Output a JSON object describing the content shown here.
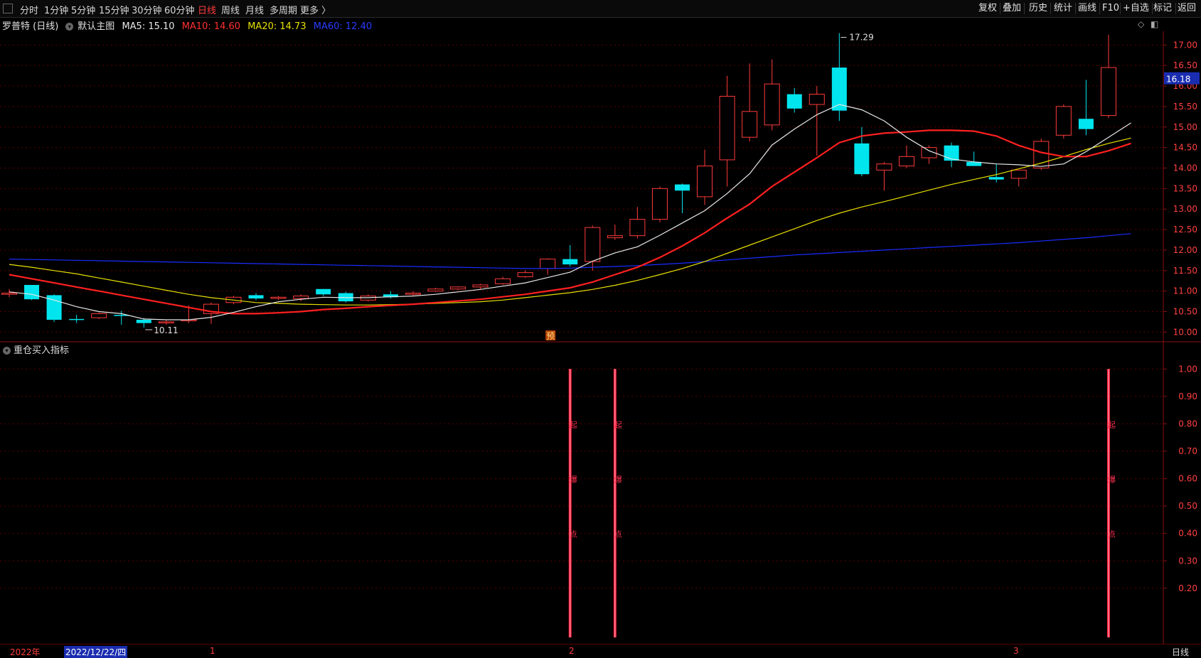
{
  "toolbar": {
    "periods": [
      "分时",
      "1分钟",
      "5分钟",
      "15分钟",
      "30分钟",
      "60分钟",
      "日线",
      "周线",
      "月线",
      "多周期",
      "更多 〉"
    ],
    "active_period": "日线",
    "right_buttons": [
      "复权",
      "叠加",
      "历史",
      "统计",
      "画线",
      "F10",
      "+自选",
      "标记",
      "返回"
    ]
  },
  "main_header": {
    "stock": "罗普特 (日线)",
    "template": "默认主图",
    "ma5": "MA5: 15.10",
    "ma10": "MA10: 14.60",
    "ma20": "MA20: 14.73",
    "ma60": "MA60: 12.40"
  },
  "sub_header": {
    "title": "重仓买入指标"
  },
  "bottom_bar": {
    "year_label": "2022年",
    "date_label": "2022/12/22/四",
    "month_ticks": [
      "1",
      "2",
      "3"
    ],
    "period_label": "日线"
  },
  "colors": {
    "up": "#ff3b3b",
    "down": "#00e5ee",
    "ma5": "#e8e8e8",
    "ma10": "#ff2020",
    "ma20": "#e8e000",
    "ma60": "#1a2cff",
    "grid": "#5a0000",
    "axis": "#8a1010"
  },
  "chart_data": {
    "type": "candlestick",
    "price_axis": {
      "range": [
        9.85,
        17.3
      ],
      "ticks": [
        "17.00",
        "16.50",
        "16.00",
        "15.50",
        "15.00",
        "14.50",
        "14.00",
        "13.50",
        "13.00",
        "12.50",
        "12.00",
        "11.50",
        "11.00",
        "10.50",
        "10.00"
      ]
    },
    "last_price_label": "16.18",
    "annotations": {
      "high": "17.29",
      "low": "10.11",
      "marker": "预"
    },
    "candles": [
      {
        "o": 10.92,
        "h": 11.05,
        "l": 10.85,
        "c": 10.95
      },
      {
        "o": 11.15,
        "h": 11.15,
        "l": 10.78,
        "c": 10.8
      },
      {
        "o": 10.9,
        "h": 10.92,
        "l": 10.25,
        "c": 10.3
      },
      {
        "o": 10.32,
        "h": 10.42,
        "l": 10.22,
        "c": 10.3
      },
      {
        "o": 10.35,
        "h": 10.48,
        "l": 10.32,
        "c": 10.45
      },
      {
        "o": 10.42,
        "h": 10.52,
        "l": 10.18,
        "c": 10.4
      },
      {
        "o": 10.3,
        "h": 10.34,
        "l": 10.11,
        "c": 10.22
      },
      {
        "o": 10.25,
        "h": 10.3,
        "l": 10.18,
        "c": 10.25
      },
      {
        "o": 10.3,
        "h": 10.65,
        "l": 10.22,
        "c": 10.3
      },
      {
        "o": 10.45,
        "h": 10.72,
        "l": 10.2,
        "c": 10.68
      },
      {
        "o": 10.72,
        "h": 10.88,
        "l": 10.68,
        "c": 10.85
      },
      {
        "o": 10.9,
        "h": 10.95,
        "l": 10.78,
        "c": 10.82
      },
      {
        "o": 10.82,
        "h": 10.88,
        "l": 10.78,
        "c": 10.85
      },
      {
        "o": 10.82,
        "h": 10.92,
        "l": 10.75,
        "c": 10.88
      },
      {
        "o": 11.05,
        "h": 11.05,
        "l": 10.88,
        "c": 10.92
      },
      {
        "o": 10.95,
        "h": 10.98,
        "l": 10.72,
        "c": 10.75
      },
      {
        "o": 10.78,
        "h": 10.92,
        "l": 10.75,
        "c": 10.88
      },
      {
        "o": 10.92,
        "h": 11.0,
        "l": 10.82,
        "c": 10.85
      },
      {
        "o": 10.92,
        "h": 11.0,
        "l": 10.88,
        "c": 10.95
      },
      {
        "o": 11.0,
        "h": 11.08,
        "l": 10.98,
        "c": 11.05
      },
      {
        "o": 11.05,
        "h": 11.12,
        "l": 11.02,
        "c": 11.1
      },
      {
        "o": 11.1,
        "h": 11.18,
        "l": 11.05,
        "c": 11.15
      },
      {
        "o": 11.18,
        "h": 11.35,
        "l": 11.15,
        "c": 11.3
      },
      {
        "o": 11.35,
        "h": 11.5,
        "l": 11.32,
        "c": 11.45
      },
      {
        "o": 11.55,
        "h": 11.8,
        "l": 11.4,
        "c": 11.78
      },
      {
        "o": 11.78,
        "h": 12.12,
        "l": 11.6,
        "c": 11.65
      },
      {
        "o": 11.72,
        "h": 12.6,
        "l": 11.5,
        "c": 12.55
      },
      {
        "o": 12.3,
        "h": 12.62,
        "l": 12.25,
        "c": 12.35
      },
      {
        "o": 12.35,
        "h": 13.05,
        "l": 12.28,
        "c": 12.75
      },
      {
        "o": 12.75,
        "h": 13.55,
        "l": 12.68,
        "c": 13.5
      },
      {
        "o": 13.6,
        "h": 13.62,
        "l": 12.9,
        "c": 13.45
      },
      {
        "o": 13.3,
        "h": 14.45,
        "l": 13.1,
        "c": 14.05
      },
      {
        "o": 14.2,
        "h": 16.25,
        "l": 13.55,
        "c": 15.75
      },
      {
        "o": 14.75,
        "h": 16.55,
        "l": 14.65,
        "c": 15.38
      },
      {
        "o": 15.05,
        "h": 16.65,
        "l": 14.92,
        "c": 16.05
      },
      {
        "o": 15.8,
        "h": 15.95,
        "l": 15.35,
        "c": 15.45
      },
      {
        "o": 15.55,
        "h": 16.0,
        "l": 14.3,
        "c": 15.8
      },
      {
        "o": 16.45,
        "h": 17.29,
        "l": 15.15,
        "c": 15.4
      },
      {
        "o": 14.6,
        "h": 15.0,
        "l": 13.8,
        "c": 13.85
      },
      {
        "o": 13.95,
        "h": 14.15,
        "l": 13.45,
        "c": 14.1
      },
      {
        "o": 14.05,
        "h": 14.55,
        "l": 14.0,
        "c": 14.28
      },
      {
        "o": 14.25,
        "h": 14.55,
        "l": 14.1,
        "c": 14.5
      },
      {
        "o": 14.55,
        "h": 14.62,
        "l": 14.02,
        "c": 14.18
      },
      {
        "o": 14.15,
        "h": 14.4,
        "l": 14.05,
        "c": 14.05
      },
      {
        "o": 13.78,
        "h": 14.1,
        "l": 13.65,
        "c": 13.72
      },
      {
        "o": 13.75,
        "h": 13.95,
        "l": 13.55,
        "c": 13.95
      },
      {
        "o": 14.0,
        "h": 14.72,
        "l": 13.95,
        "c": 14.65
      },
      {
        "o": 14.8,
        "h": 15.55,
        "l": 14.72,
        "c": 15.5
      },
      {
        "o": 15.2,
        "h": 16.15,
        "l": 14.8,
        "c": 14.95
      },
      {
        "o": 15.28,
        "h": 17.25,
        "l": 15.22,
        "c": 16.45
      }
    ],
    "ma5": [
      10.98,
      10.92,
      10.78,
      10.62,
      10.5,
      10.45,
      10.32,
      10.3,
      10.3,
      10.36,
      10.48,
      10.62,
      10.74,
      10.8,
      10.85,
      10.84,
      10.84,
      10.86,
      10.88,
      10.92,
      10.98,
      11.04,
      11.12,
      11.2,
      11.33,
      11.46,
      11.73,
      11.93,
      12.08,
      12.36,
      12.66,
      12.96,
      13.38,
      13.86,
      14.56,
      14.95,
      15.3,
      15.55,
      15.42,
      15.15,
      14.75,
      14.42,
      14.22,
      14.15,
      14.1,
      14.08,
      14.04,
      14.1,
      14.4,
      14.75,
      15.1
    ],
    "ma10": [
      11.4,
      11.3,
      11.2,
      11.1,
      11.0,
      10.9,
      10.8,
      10.7,
      10.6,
      10.5,
      10.45,
      10.45,
      10.47,
      10.5,
      10.55,
      10.58,
      10.62,
      10.65,
      10.68,
      10.72,
      10.76,
      10.8,
      10.86,
      10.92,
      11.0,
      11.08,
      11.22,
      11.4,
      11.58,
      11.82,
      12.1,
      12.42,
      12.78,
      13.12,
      13.55,
      13.9,
      14.25,
      14.62,
      14.78,
      14.85,
      14.88,
      14.92,
      14.92,
      14.9,
      14.78,
      14.55,
      14.38,
      14.28,
      14.28,
      14.42,
      14.6
    ],
    "ma20": [
      11.65,
      11.58,
      11.5,
      11.42,
      11.32,
      11.22,
      11.12,
      11.02,
      10.92,
      10.84,
      10.78,
      10.72,
      10.7,
      10.68,
      10.67,
      10.66,
      10.66,
      10.67,
      10.68,
      10.7,
      10.72,
      10.74,
      10.78,
      10.84,
      10.9,
      10.96,
      11.04,
      11.14,
      11.26,
      11.4,
      11.55,
      11.72,
      11.92,
      12.12,
      12.32,
      12.52,
      12.72,
      12.9,
      13.05,
      13.18,
      13.32,
      13.46,
      13.6,
      13.72,
      13.84,
      13.98,
      14.12,
      14.28,
      14.45,
      14.6,
      14.73
    ],
    "ma60": [
      11.78,
      11.77,
      11.76,
      11.75,
      11.74,
      11.73,
      11.72,
      11.71,
      11.7,
      11.69,
      11.68,
      11.67,
      11.66,
      11.65,
      11.64,
      11.63,
      11.62,
      11.61,
      11.6,
      11.59,
      11.58,
      11.57,
      11.56,
      11.55,
      11.55,
      11.56,
      11.58,
      11.6,
      11.62,
      11.65,
      11.68,
      11.72,
      11.76,
      11.8,
      11.84,
      11.88,
      11.91,
      11.94,
      11.97,
      12.0,
      12.03,
      12.06,
      12.09,
      12.12,
      12.15,
      12.18,
      12.22,
      12.26,
      12.3,
      12.35,
      12.4
    ],
    "indicator": {
      "title": "重仓买入指标",
      "range": [
        0.0,
        1.05
      ],
      "ticks": [
        "1.00",
        "0.90",
        "0.80",
        "0.70",
        "0.60",
        "0.50",
        "0.40",
        "0.30",
        "0.20"
      ],
      "signal_bars": [
        25,
        27,
        49
      ],
      "signal_value": 1.0,
      "bar_text": [
        "起",
        "爆",
        "点"
      ]
    }
  }
}
